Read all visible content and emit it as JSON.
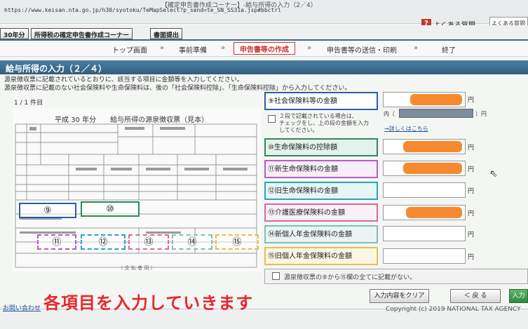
{
  "browser": {
    "url": "https://www.keisan.nta.go.jp/h30/syotoku/TeMapSelect?p_send=te_SN_SS31a.jsp#bbctrl",
    "window_title": "【確定申告書作成コーナー】-給与所得の入力（2／4）",
    "help_icon": "?",
    "faq_label": "よくある質問",
    "faq_search_placeholder": "よくある質問"
  },
  "toolbar": {
    "year_label": "30年分",
    "corner_label": "所得税の確定申告書作成コーナー",
    "print_label": "書面提出"
  },
  "steps": {
    "items": [
      "トップ画面",
      "事前準備",
      "申告書等の作成",
      "申告書等の送信・印刷",
      "終了"
    ],
    "separator": "»",
    "active_index": 2
  },
  "section": {
    "title": "給与所得の入力（２／４）",
    "instruction_1": "源泉徴収票に記載されているとおりに、該当する項目に金額等を入力してください。",
    "instruction_2": "源泉徴収票に記載のない社会保険料や生命保険料は、後の「社会保険料控除」、「生命保険料控除」から入力してください。",
    "count": "1 / 1 件目"
  },
  "sample_form": {
    "title": "平成 30 年分　　給与所得の源泉徴収票（見本）",
    "footer": "（ 支 払 者 用 ）",
    "markers": [
      "⑨",
      "⑩",
      "⑪",
      "⑫",
      "⑬",
      "⑭",
      "⑮"
    ]
  },
  "fields": [
    {
      "label": "⑨社会保険料等の金額",
      "unit": "円",
      "color": "#2e5fa8",
      "bg": "#ffffff"
    },
    {
      "label": "⑩生命保険料の控除額",
      "unit": "円",
      "color": "#2e8b57",
      "bg": "#e3f2ea"
    },
    {
      "label": "⑪新生命保険料の金額",
      "unit": "円",
      "color": "#b35fc7",
      "bg": "#f7eefa"
    },
    {
      "label": "⑫旧生命保険料の金額",
      "unit": "円",
      "color": "#2aa6b5",
      "bg": "#e6f5f6"
    },
    {
      "label": "⑬介護医療保険料の金額",
      "unit": "円",
      "color": "#d96aa0",
      "bg": "#fbf0f5"
    },
    {
      "label": "⑭新個人年金保険料の金額",
      "unit": "円",
      "color": "#7fc0b8",
      "bg": "#eaf5f3"
    },
    {
      "label": "⑮旧個人年金保険料の金額",
      "unit": "円",
      "color": "#e2c24a",
      "bg": "#fbf6e4"
    }
  ],
  "two_line_note": {
    "line1": "２段で記載されている場合は、",
    "line2": "チェックをし、上の段の金額を入力",
    "line3": "してください。",
    "inner_prefix": "内（",
    "inner_suffix": "）円",
    "detail_link": "→詳しくはこちら"
  },
  "no_description_checkbox": "源泉徴収票の⑨から⑮欄の全てに記載がない。",
  "buttons": {
    "clear": "入力内容をクリア",
    "back": "＜ 戻 る",
    "next": "入力"
  },
  "overlay_text": "各項目を入力していきます",
  "footer": {
    "contact": "お問い合わせ",
    "copyright": "Copyright (c) 2019 NATIONAL TAX AGENCY"
  }
}
